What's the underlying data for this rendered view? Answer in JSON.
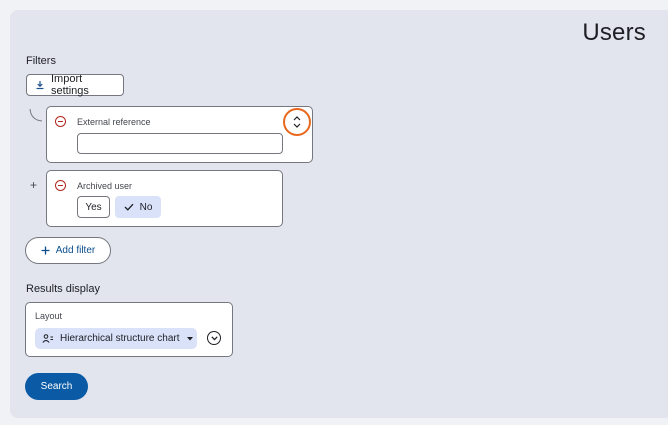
{
  "header": {
    "title": "Users"
  },
  "filters": {
    "section_label": "Filters",
    "import_label": "Import settings",
    "items": [
      {
        "label": "External reference",
        "value": ""
      },
      {
        "label": "Archived user",
        "options": [
          "Yes",
          "No"
        ],
        "selected": "No"
      }
    ],
    "connector_symbol": "+",
    "add_filter_label": "Add filter"
  },
  "results": {
    "section_label": "Results display",
    "layout_label": "Layout",
    "layout_value": "Hierarchical structure chart"
  },
  "actions": {
    "search_label": "Search"
  },
  "colors": {
    "accent": "#0b5aa5",
    "danger": "#b3261e",
    "focus": "#e8671c",
    "chip_selected": "#dae2f9"
  },
  "icons": [
    "download-icon",
    "remove-icon",
    "reorder-icon",
    "check-icon",
    "plus-icon",
    "org-chart-icon",
    "caret-down-icon",
    "expand-icon"
  ]
}
